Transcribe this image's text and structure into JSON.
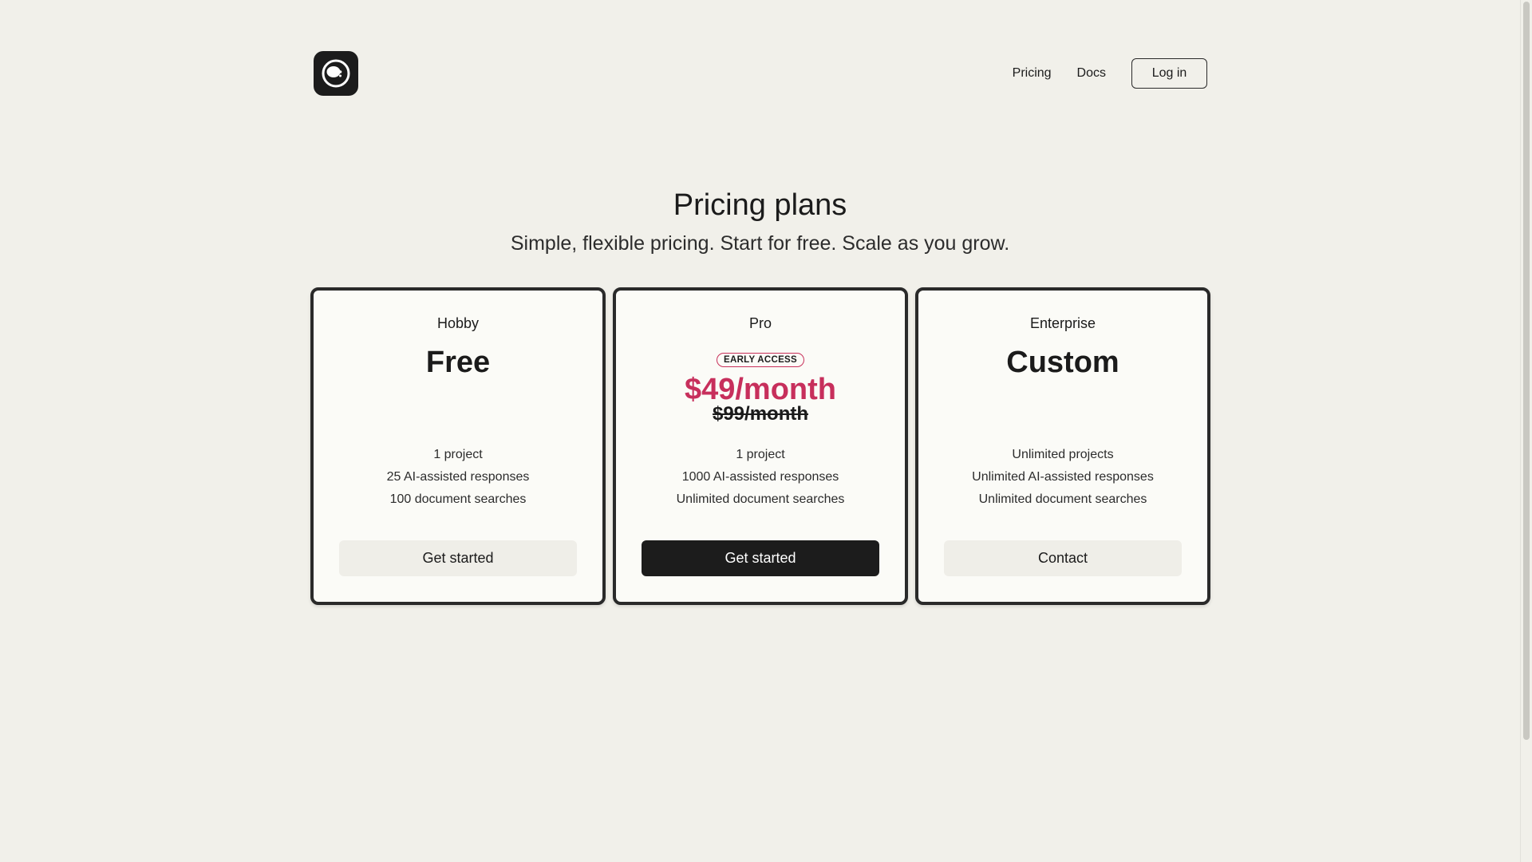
{
  "header": {
    "logo_icon": "eye-logo-icon",
    "nav": {
      "pricing_label": "Pricing",
      "docs_label": "Docs",
      "login_label": "Log in"
    }
  },
  "hero": {
    "title": "Pricing plans",
    "subtitle": "Simple, flexible pricing. Start for free. Scale as you grow."
  },
  "plans": [
    {
      "name": "Hobby",
      "price": "Free",
      "features": [
        "1 project",
        "25 AI-assisted responses",
        "100 document searches"
      ],
      "cta": "Get started"
    },
    {
      "name": "Pro",
      "badge": "EARLY ACCESS",
      "price": "$49/month",
      "old_price": "$99/month",
      "features": [
        "1 project",
        "1000 AI-assisted responses",
        "Unlimited document searches"
      ],
      "cta": "Get started"
    },
    {
      "name": "Enterprise",
      "price": "Custom",
      "features": [
        "Unlimited projects",
        "Unlimited AI-assisted responses",
        "Unlimited document searches"
      ],
      "cta": "Contact"
    }
  ],
  "colors": {
    "background": "#f1f0ea",
    "card": "#fbfbf7",
    "accent": "#c72f5c",
    "dark": "#1c1c1c"
  }
}
